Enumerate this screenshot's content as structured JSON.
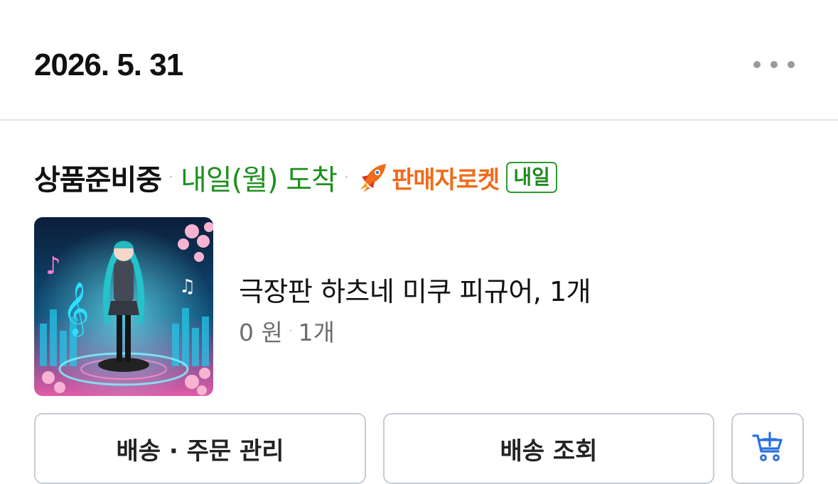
{
  "order": {
    "date": "2026. 5. 31",
    "menu_icon": "more-horizontal-icon"
  },
  "item": {
    "status": "상품준비중",
    "separator": "·",
    "arrival": "내일(월) 도착",
    "delivery_label": "판매자로켓",
    "delivery_icon": "rocket-icon",
    "badge": "내일",
    "product_name": "극장판 하츠네 미쿠 피규어, 1개",
    "price": "0 원",
    "quantity": "1개",
    "colors": {
      "arrival": "#1e8f1e",
      "rocket": "#f06b1a",
      "badge": "#2d9a2d"
    }
  },
  "actions": {
    "manage_label": "배송 · 주문 관리",
    "track_label": "배송 조회",
    "cart_icon": "add-to-cart-icon"
  }
}
